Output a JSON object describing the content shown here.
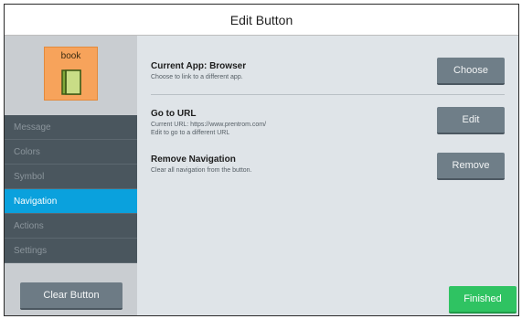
{
  "title": "Edit Button",
  "tile": {
    "label": "book",
    "icon": "book-icon",
    "color": "#f7a35b"
  },
  "menu": [
    {
      "label": "Message",
      "active": false
    },
    {
      "label": "Colors",
      "active": false
    },
    {
      "label": "Symbol",
      "active": false
    },
    {
      "label": "Navigation",
      "active": true
    },
    {
      "label": "Actions",
      "active": false
    },
    {
      "label": "Settings",
      "active": false
    }
  ],
  "clear_button": "Clear Button",
  "sections": {
    "app": {
      "title": "Current App: Browser",
      "desc": "Choose to link to a different app.",
      "button": "Choose"
    },
    "url": {
      "title": "Go to URL",
      "current": "Current URL: https://www.prentrom.com/",
      "desc": "Edit to go to a different URL",
      "button": "Edit"
    },
    "remove": {
      "title": "Remove Navigation",
      "desc": "Clear all navigation from the button.",
      "button": "Remove"
    }
  },
  "finished_button": "Finished",
  "colors": {
    "accent": "#0aa1dd",
    "success": "#2fc362",
    "sidebar": "#4a565e"
  }
}
